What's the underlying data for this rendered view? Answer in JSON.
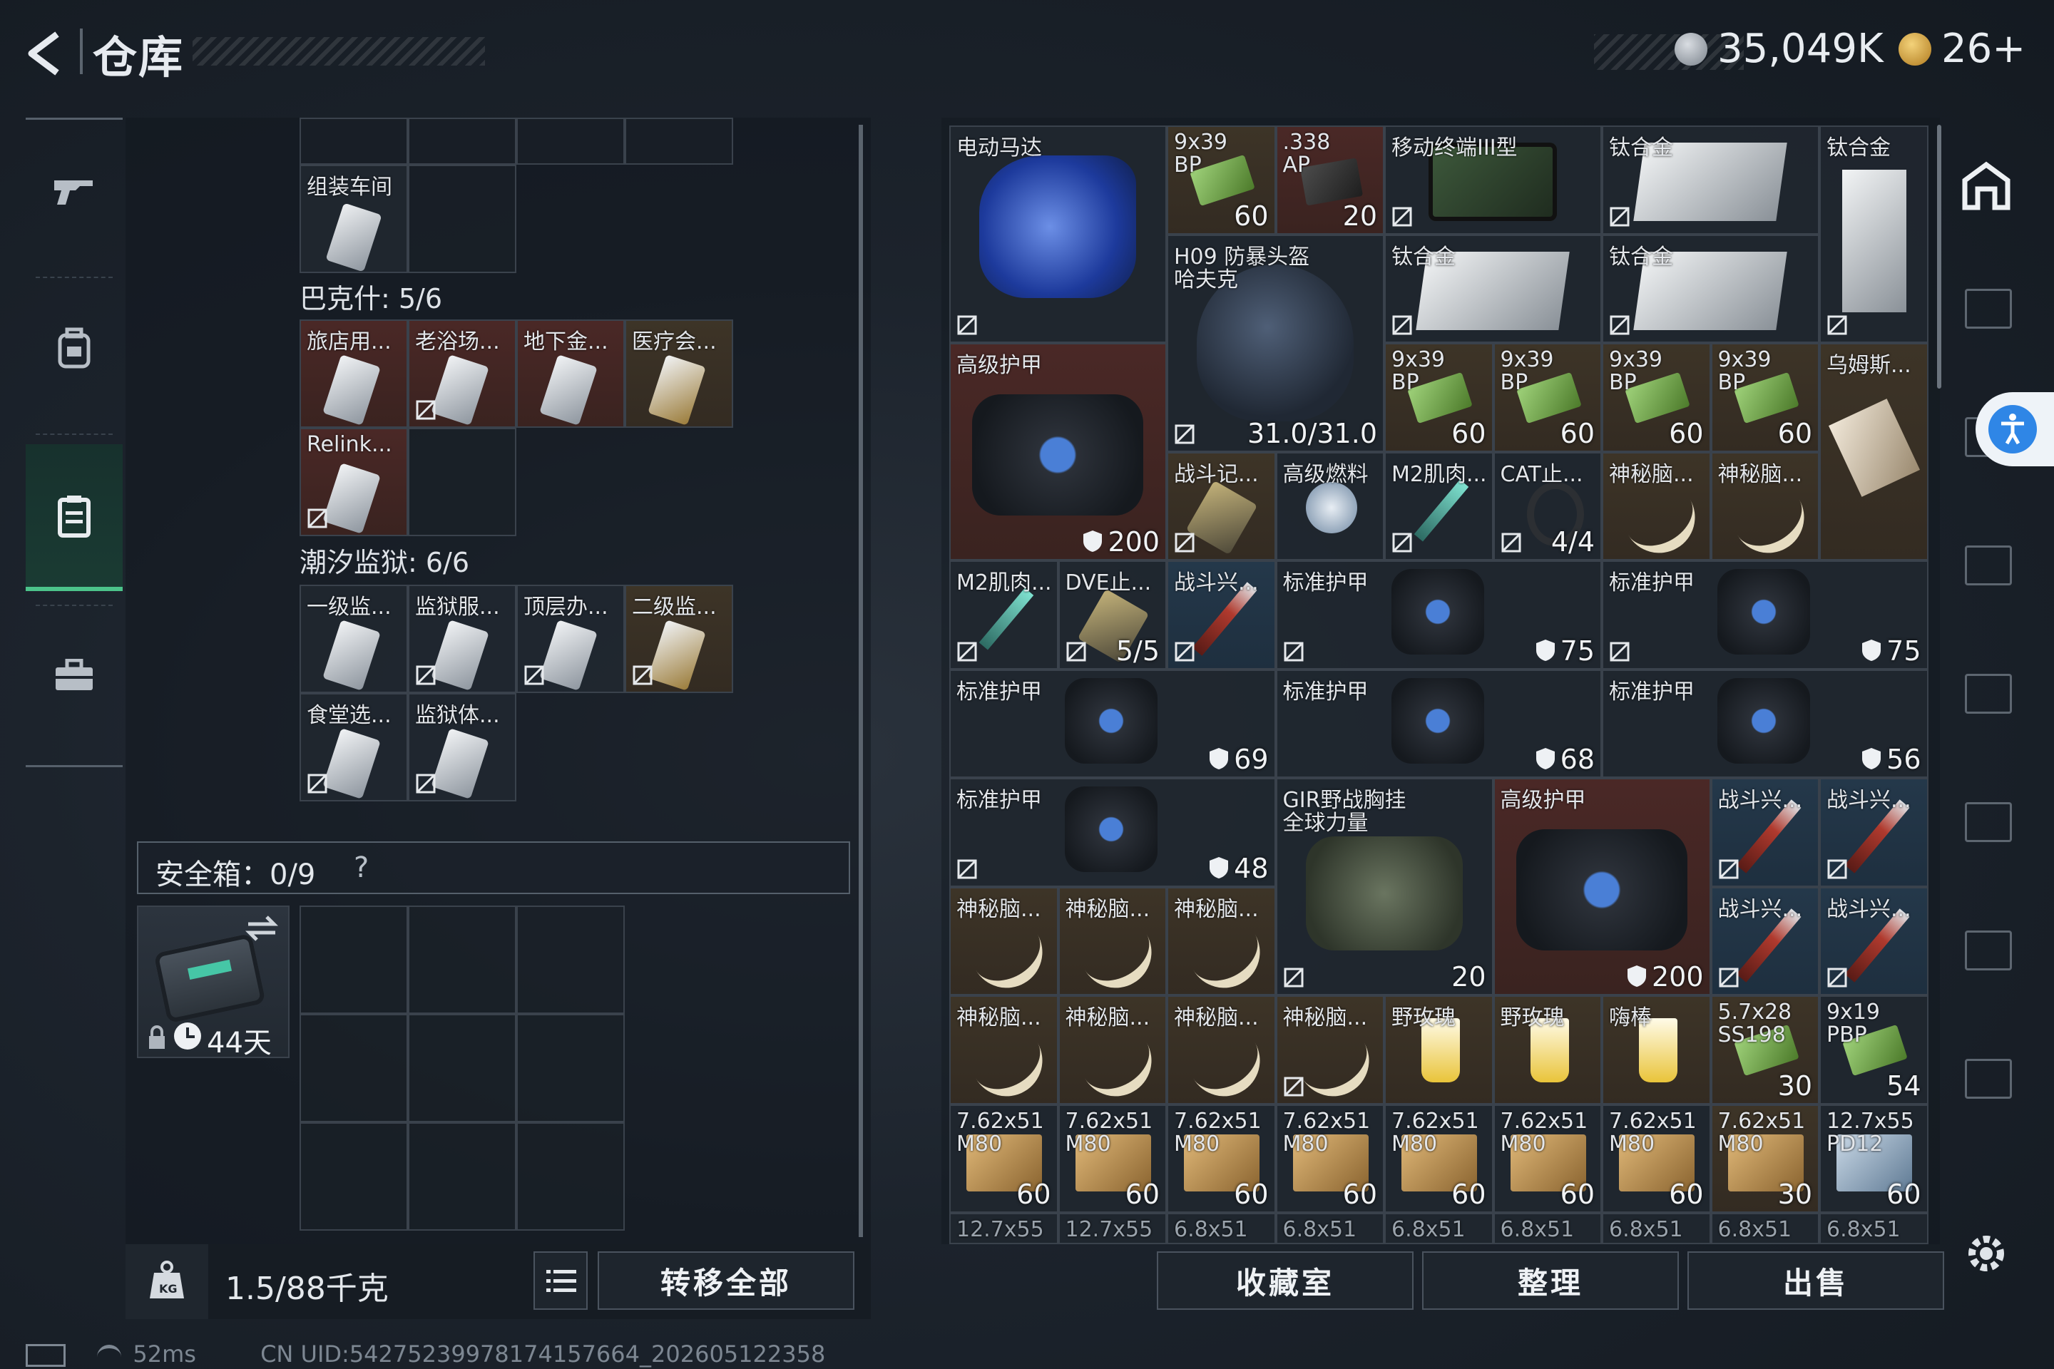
{
  "header": {
    "title": "仓库",
    "currency_amount": "35,049K",
    "level_value": "26+"
  },
  "left": {
    "assembly_room_label": "组装车间",
    "bakesh_title": "巴克什: 5/6",
    "bakesh_items": [
      "旅店用...",
      "老浴场...",
      "地下金...",
      "医疗会...",
      "Relink..."
    ],
    "prison_title": "潮汐监狱: 6/6",
    "prison_items": [
      "一级监...",
      "监狱服...",
      "顶层办...",
      "二级监...",
      "食堂选...",
      "监狱体..."
    ],
    "safe_label": "安全箱：0/9",
    "safe_help": "?",
    "safe_days": "44天",
    "weight": "1.5/88千克",
    "transfer_all": "转移全部"
  },
  "right": {
    "items": [
      {
        "id": "motor",
        "label": "电动马达",
        "label2": "",
        "count": ""
      },
      {
        "id": "ammo939a",
        "label": "9x39",
        "label2": "BP",
        "count": "60"
      },
      {
        "id": "ammo338",
        "label": ".338",
        "label2": "AP",
        "count": "20"
      },
      {
        "id": "terminal",
        "label": "移动终端III型",
        "label2": "",
        "count": ""
      },
      {
        "id": "ti1",
        "label": "钛合金",
        "label2": "",
        "count": ""
      },
      {
        "id": "ti2",
        "label": "钛合金",
        "label2": "",
        "count": ""
      },
      {
        "id": "helmet",
        "label": "H09 防暴头盔",
        "label2": "哈夫克",
        "count": "31.0/31.0"
      },
      {
        "id": "ti3",
        "label": "钛合金",
        "label2": "",
        "count": ""
      },
      {
        "id": "ti4",
        "label": "钛合金",
        "label2": "",
        "count": ""
      },
      {
        "id": "armor1",
        "label": "高级护甲",
        "label2": "",
        "count": "200"
      },
      {
        "id": "b1",
        "label": "9x39",
        "label2": "BP",
        "count": "60"
      },
      {
        "id": "b2",
        "label": "9x39",
        "label2": "BP",
        "count": "60"
      },
      {
        "id": "b3",
        "label": "9x39",
        "label2": "BP",
        "count": "60"
      },
      {
        "id": "b4",
        "label": "9x39",
        "label2": "BP",
        "count": "60"
      },
      {
        "id": "ums",
        "label": "乌姆斯...",
        "label2": "",
        "count": ""
      },
      {
        "id": "combat1",
        "label": "战斗记...",
        "label2": "",
        "count": ""
      },
      {
        "id": "fuel",
        "label": "高级燃料",
        "label2": "",
        "count": ""
      },
      {
        "id": "m2a",
        "label": "M2肌肉...",
        "label2": "",
        "count": ""
      },
      {
        "id": "cat",
        "label": "CAT止...",
        "label2": "",
        "count": "4/4"
      },
      {
        "id": "brain1",
        "label": "神秘脑...",
        "label2": "",
        "count": ""
      },
      {
        "id": "brain2",
        "label": "神秘脑...",
        "label2": "",
        "count": ""
      },
      {
        "id": "m2b",
        "label": "M2肌肉...",
        "label2": "",
        "count": ""
      },
      {
        "id": "dve",
        "label": "DVE止...",
        "label2": "",
        "count": "5/5"
      },
      {
        "id": "fight1",
        "label": "战斗兴...",
        "label2": "",
        "count": ""
      },
      {
        "id": "std1",
        "label": "标准护甲",
        "label2": "",
        "count": "75"
      },
      {
        "id": "std2",
        "label": "标准护甲",
        "label2": "",
        "count": "75"
      },
      {
        "id": "std3",
        "label": "标准护甲",
        "label2": "",
        "count": "69"
      },
      {
        "id": "std4",
        "label": "标准护甲",
        "label2": "",
        "count": "68"
      },
      {
        "id": "std5",
        "label": "标准护甲",
        "label2": "",
        "count": "56"
      },
      {
        "id": "std6",
        "label": "标准护甲",
        "label2": "",
        "count": "48"
      },
      {
        "id": "gir",
        "label": "GIR野战胸挂",
        "label2": "全球力量",
        "count": "20"
      },
      {
        "id": "armor2",
        "label": "高级护甲",
        "label2": "",
        "count": "200"
      },
      {
        "id": "fight2",
        "label": "战斗兴...",
        "label2": "",
        "count": ""
      },
      {
        "id": "fight3",
        "label": "战斗兴...",
        "label2": "",
        "count": ""
      },
      {
        "id": "brain3",
        "label": "神秘脑...",
        "label2": "",
        "count": ""
      },
      {
        "id": "brain4",
        "label": "神秘脑...",
        "label2": "",
        "count": ""
      },
      {
        "id": "brain5",
        "label": "神秘脑...",
        "label2": "",
        "count": ""
      },
      {
        "id": "fight4",
        "label": "战斗兴...",
        "label2": "",
        "count": ""
      },
      {
        "id": "fight5",
        "label": "战斗兴...",
        "label2": "",
        "count": ""
      },
      {
        "id": "brain6",
        "label": "神秘脑...",
        "label2": "",
        "count": ""
      },
      {
        "id": "brain7",
        "label": "神秘脑...",
        "label2": "",
        "count": ""
      },
      {
        "id": "brain8",
        "label": "神秘脑...",
        "label2": "",
        "count": ""
      },
      {
        "id": "brain9",
        "label": "神秘脑...",
        "label2": "",
        "count": ""
      },
      {
        "id": "rose1",
        "label": "野玫瑰",
        "label2": "",
        "count": ""
      },
      {
        "id": "rose2",
        "label": "野玫瑰",
        "label2": "",
        "count": ""
      },
      {
        "id": "hai",
        "label": "嗨棒",
        "label2": "",
        "count": ""
      },
      {
        "id": "ss",
        "label": "5.7x28",
        "label2": "SS198",
        "count": "30"
      },
      {
        "id": "pbp",
        "label": "9x19",
        "label2": "PBP",
        "count": "54"
      },
      {
        "id": "m80a",
        "label": "7.62x51",
        "label2": "M80",
        "count": "60"
      },
      {
        "id": "m80b",
        "label": "7.62x51",
        "label2": "M80",
        "count": "60"
      },
      {
        "id": "m80c",
        "label": "7.62x51",
        "label2": "M80",
        "count": "60"
      },
      {
        "id": "m80d",
        "label": "7.62x51",
        "label2": "M80",
        "count": "60"
      },
      {
        "id": "m80e",
        "label": "7.62x51",
        "label2": "M80",
        "count": "60"
      },
      {
        "id": "m80f",
        "label": "7.62x51",
        "label2": "M80",
        "count": "60"
      },
      {
        "id": "m80g",
        "label": "7.62x51",
        "label2": "M80",
        "count": "60"
      },
      {
        "id": "m80h",
        "label": "7.62x51",
        "label2": "M80",
        "count": "30"
      },
      {
        "id": "pd12",
        "label": "12.7x55",
        "label2": "PD12",
        "count": "60"
      }
    ],
    "partial_row": [
      "12.7x55",
      "12.7x55",
      "6.8x51",
      "6.8x51",
      "6.8x51",
      "6.8x51",
      "6.8x51",
      "6.8x51",
      "6.8x51"
    ],
    "btn_collection": "收藏室",
    "btn_sort": "整理",
    "btn_sell": "出售"
  },
  "status": {
    "ping": "52ms",
    "uid": "CN UID:5427523997817415766​4_202605122358"
  }
}
